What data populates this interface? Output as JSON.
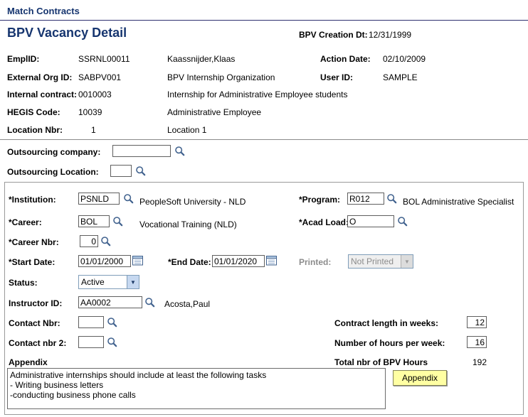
{
  "colors": {
    "heading": "#16356f",
    "top_rule": "#2e3170",
    "separator": "#8a8a8a",
    "button_bg": "#ffffa3"
  },
  "breadcrumb": {
    "label": "Match Contracts"
  },
  "header": {
    "title": "BPV Vacancy Detail",
    "creation_label": "BPV Creation Dt:",
    "creation_value": "12/31/1999"
  },
  "summary": {
    "emplid_label": "EmplID:",
    "emplid_value": "SSRNL00011",
    "emplid_desc": "Kaassnijder,Klaas",
    "action_date_label": "Action Date:",
    "action_date_value": "02/10/2009",
    "external_org_label": "External Org ID:",
    "external_org_value": "SABPV001",
    "external_org_desc": "BPV Internship Organization",
    "user_id_label": "User ID:",
    "user_id_value": "SAMPLE",
    "internal_contract_label": "Internal contract:",
    "internal_contract_value": "0010003",
    "internal_contract_desc": "Internship for Administrative Employee students",
    "hegis_label": "HEGIS Code:",
    "hegis_value": "10039",
    "hegis_desc": "Administrative Employee",
    "location_label": "Location Nbr:",
    "location_value": "1",
    "location_desc": "Location 1"
  },
  "outsourcing": {
    "company_label": "Outsourcing company:",
    "company_value": "",
    "location_label": "Outsourcing Location:",
    "location_value": ""
  },
  "detail": {
    "institution": {
      "label": "*Institution:",
      "value": "PSNLD",
      "desc": "PeopleSoft University -  NLD"
    },
    "program": {
      "label": "*Program:",
      "value": "R012",
      "desc": "BOL Administrative Specialist"
    },
    "career": {
      "label": "*Career:",
      "value": "BOL",
      "desc": "Vocational Training (NLD)"
    },
    "acad_load": {
      "label": "*Acad Load:",
      "value": "O"
    },
    "career_nbr": {
      "label": "*Career Nbr:",
      "value": "0"
    },
    "start_date": {
      "label": "*Start Date:",
      "value": "01/01/2000"
    },
    "end_date": {
      "label": "*End Date:",
      "value": "01/01/2020"
    },
    "printed": {
      "label": "Printed:",
      "value": "Not Printed"
    },
    "status": {
      "label": "Status:",
      "value": "Active"
    },
    "instructor": {
      "label": "Instructor ID:",
      "value": "AA0002",
      "desc": "Acosta,Paul"
    },
    "contact_nbr": {
      "label": "Contact Nbr:",
      "value": ""
    },
    "contact_nbr2": {
      "label": "Contact nbr 2:",
      "value": ""
    },
    "contract_weeks": {
      "label": "Contract length in weeks:",
      "value": "12"
    },
    "hours_week": {
      "label": "Number of hours per week:",
      "value": "16"
    },
    "total_hours": {
      "label": "Total nbr of BPV Hours",
      "value": "192"
    },
    "appendix": {
      "label": "Appendix",
      "text": "Administrative internships should include at least the following tasks\n- Writing business letters\n-conducting business phone calls",
      "button": "Appendix"
    }
  }
}
